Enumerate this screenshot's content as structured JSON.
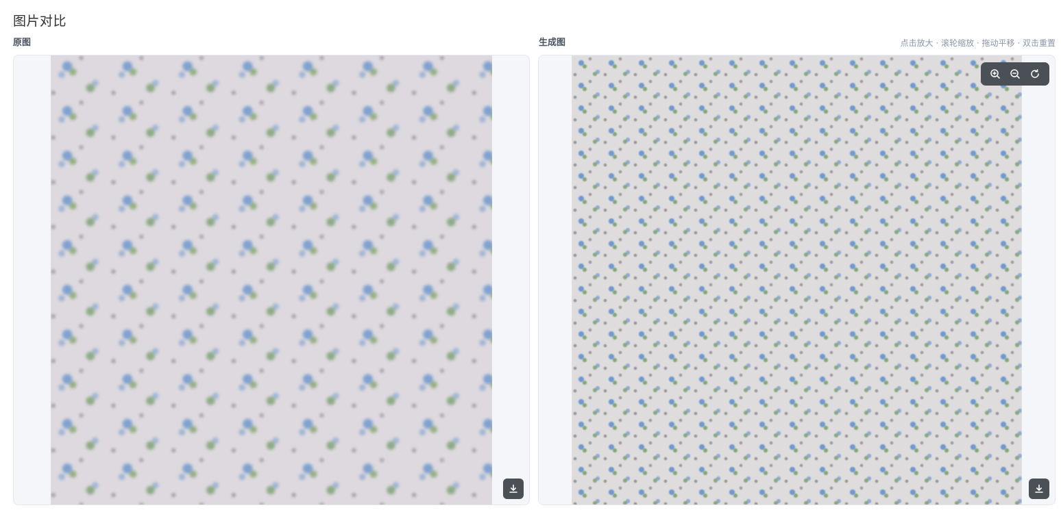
{
  "page": {
    "title": "图片对比"
  },
  "panels": {
    "original": {
      "label": "原图"
    },
    "generated": {
      "label": "生成图",
      "hint": "点击放大 · 滚轮缩放 · 拖动平移 · 双击重置"
    }
  },
  "icons": {
    "download": "download-icon",
    "zoom_in": "zoom-in-icon",
    "zoom_out": "zoom-out-icon",
    "reset": "reset-icon"
  },
  "colors": {
    "button_bg": "#4b4f56",
    "frame_bg": "#f4f6fa",
    "hint_text": "#8b96a8"
  }
}
